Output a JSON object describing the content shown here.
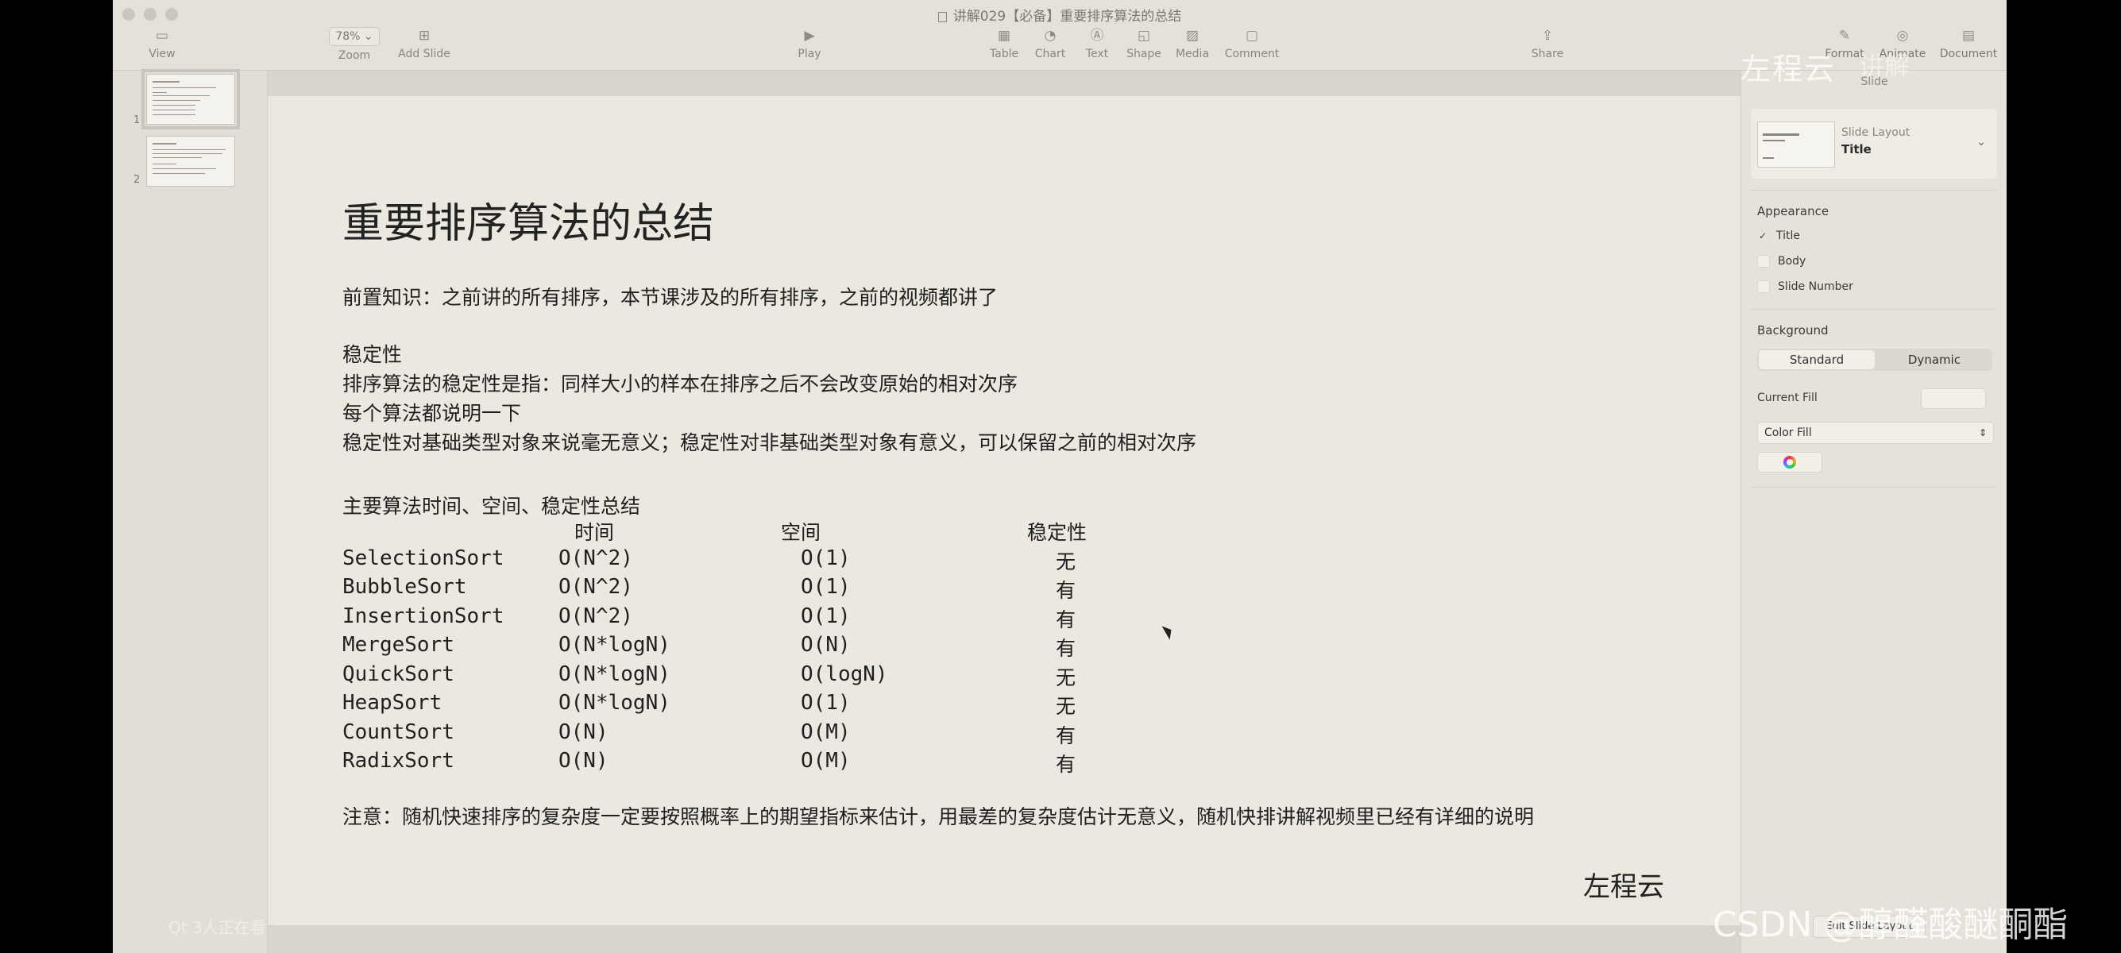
{
  "window": {
    "title": "讲解029【必备】重要排序算法的总结"
  },
  "toolbar": {
    "view": "View",
    "zoom_value": "78%",
    "zoom": "Zoom",
    "add_slide": "Add Slide",
    "play": "Play",
    "table": "Table",
    "chart": "Chart",
    "text": "Text",
    "shape": "Shape",
    "media": "Media",
    "comment": "Comment",
    "share": "Share",
    "format": "Format",
    "animate": "Animate",
    "document": "Document"
  },
  "navigator": {
    "slides": [
      "1",
      "2"
    ]
  },
  "slide": {
    "title": "重要排序算法的总结",
    "prereq": "前置知识：之前讲的所有排序，本节课涉及的所有排序，之前的视频都讲了",
    "stability_heading": "稳定性",
    "stability_def": "排序算法的稳定性是指：同样大小的样本在排序之后不会改变原始的相对次序",
    "stability_each": "每个算法都说明一下",
    "stability_note": "稳定性对基础类型对象来说毫无意义；稳定性对非基础类型对象有意义，可以保留之前的相对次序",
    "summary_heading": "主要算法时间、空间、稳定性总结",
    "table": {
      "headers": [
        "时间",
        "空间",
        "稳定性"
      ],
      "rows": [
        [
          "SelectionSort",
          "O(N^2)",
          "O(1)",
          "无"
        ],
        [
          "BubbleSort",
          "O(N^2)",
          "O(1)",
          "有"
        ],
        [
          "InsertionSort",
          "O(N^2)",
          "O(1)",
          "有"
        ],
        [
          "MergeSort",
          "O(N*logN)",
          "O(N)",
          "有"
        ],
        [
          "QuickSort",
          "O(N*logN)",
          "O(logN)",
          "无"
        ],
        [
          "HeapSort",
          "O(N*logN)",
          "O(1)",
          "无"
        ],
        [
          "CountSort",
          "O(N)",
          "O(M)",
          "有"
        ],
        [
          "RadixSort",
          "O(N)",
          "O(M)",
          "有"
        ]
      ]
    },
    "note": "注意：随机快速排序的复杂度一定要按照概率上的期望指标来估计，用最差的复杂度估计无意义，随机快排讲解视频里已经有详细的说明",
    "brand": "左程云"
  },
  "inspector": {
    "header": "Slide",
    "layout_label": "Slide Layout",
    "layout_value": "Title",
    "appearance": "Appearance",
    "title_cb": "Title",
    "body_cb": "Body",
    "slide_number_cb": "Slide Number",
    "background": "Background",
    "standard": "Standard",
    "dynamic": "Dynamic",
    "current_fill": "Current Fill",
    "color_fill": "Color Fill",
    "edit_layout": "Edit Slide Layout"
  },
  "watermarks": {
    "top": "左程云",
    "top_faint": "讲解",
    "bottom": "CSDN @醇醛酸醚酮酯",
    "bottom_left": "Qt 3人正在看"
  },
  "colors": {
    "window_bg": "#e9e6dd",
    "slide_bg": "#ebe8df",
    "text": "#1f1f1f"
  }
}
